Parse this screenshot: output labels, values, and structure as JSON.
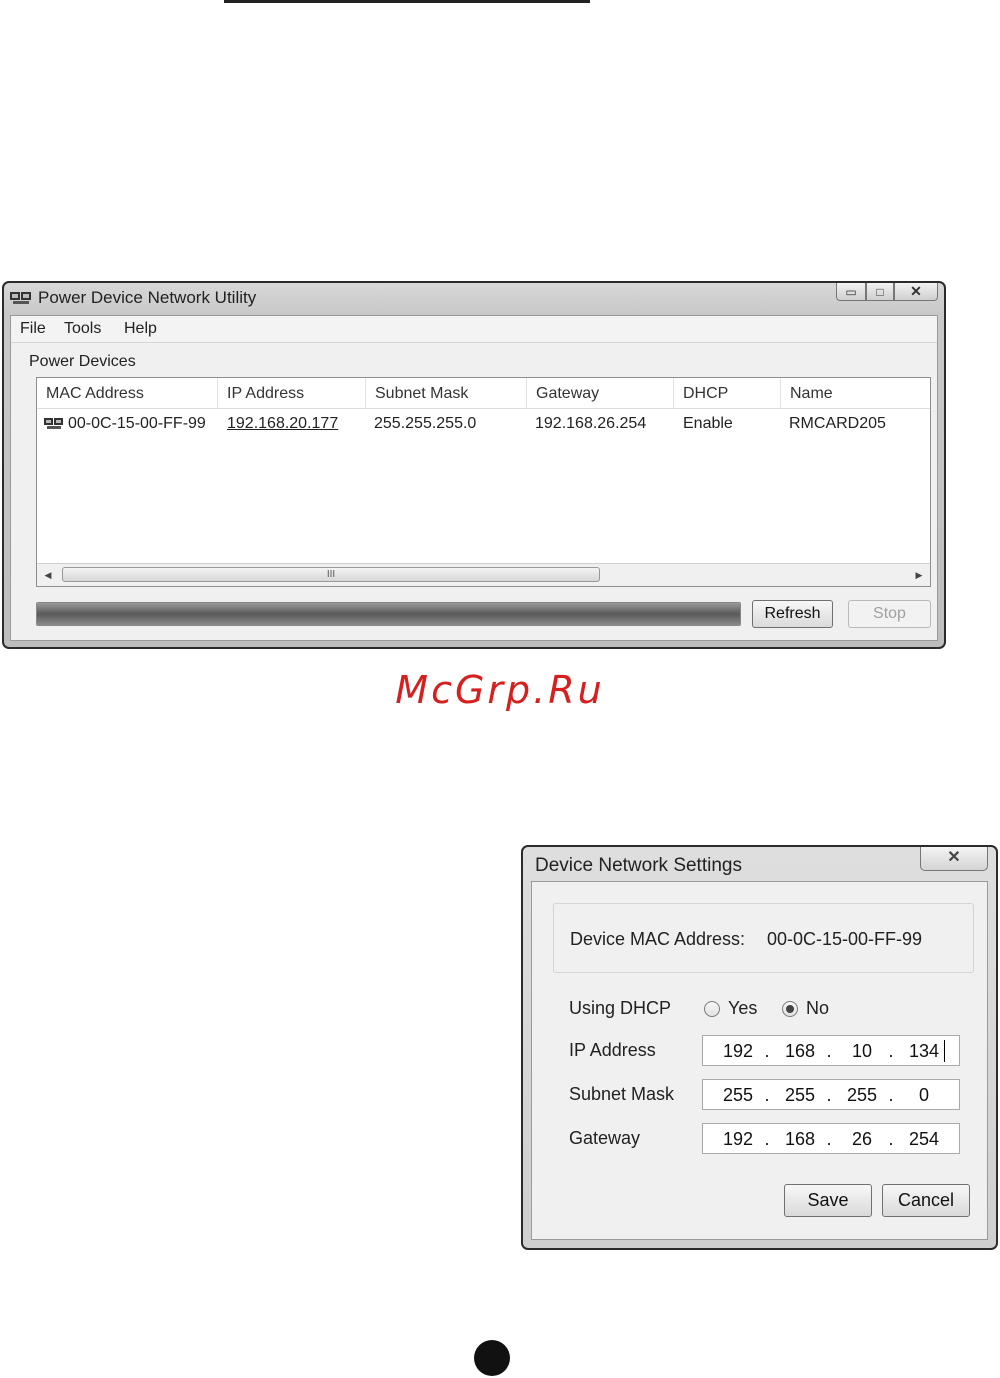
{
  "main_window": {
    "title": "Power Device Network Utility",
    "menu": [
      "File",
      "Tools",
      "Help"
    ],
    "group_label": "Power Devices",
    "columns": [
      "MAC Address",
      "IP Address",
      "Subnet Mask",
      "Gateway",
      "DHCP",
      "Name"
    ],
    "rows": [
      {
        "mac": "00-0C-15-00-FF-99",
        "ip": "192.168.20.177",
        "subnet": "255.255.255.0",
        "gateway": "192.168.26.254",
        "dhcp": "Enable",
        "name": "RMCARD205"
      }
    ],
    "scroll_grip": "III",
    "buttons": {
      "refresh": "Refresh",
      "stop": "Stop"
    },
    "icons": {
      "app": "network-device-icon",
      "row": "network-device-icon"
    }
  },
  "watermark": "McGrp.Ru",
  "dialog": {
    "title": "Device Network Settings",
    "close_glyph": "✕",
    "mac_label": "Device MAC Address:",
    "mac_value": "00-0C-15-00-FF-99",
    "dhcp_label": "Using DHCP",
    "dhcp_options": {
      "yes": "Yes",
      "no": "No"
    },
    "dhcp_selected": "No",
    "ip_label": "IP Address",
    "ip": [
      "192",
      "168",
      "10",
      "134"
    ],
    "subnet_label": "Subnet Mask",
    "subnet": [
      "255",
      "255",
      "255",
      "0"
    ],
    "gateway_label": "Gateway",
    "gateway": [
      "192",
      "168",
      "26",
      "254"
    ],
    "buttons": {
      "save": "Save",
      "cancel": "Cancel"
    }
  },
  "colors": {
    "watermark": "#d61f1f",
    "progress": "#6a6a6a"
  }
}
